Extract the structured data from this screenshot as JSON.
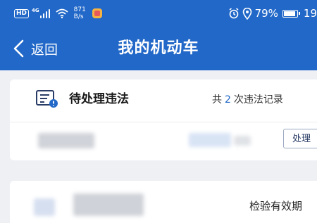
{
  "status_bar": {
    "hd_label": "HD",
    "network_type": "4G",
    "net_speed_value": "871",
    "net_speed_unit": "B/s",
    "battery_percent": "79%",
    "clock_partial": "19"
  },
  "nav": {
    "back_label": "返回",
    "title": "我的机动车"
  },
  "pending_violations": {
    "title": "待处理违法",
    "count_prefix": "共",
    "count": "2",
    "count_suffix": "次违法记录",
    "handle_button_label": "处理"
  },
  "vehicle_card": {
    "inspection_label": "检验有效期"
  },
  "colors": {
    "primary": "#2268c8",
    "background": "#eef0f4",
    "card": "#ffffff"
  },
  "icons": [
    "hd-icon",
    "signal-icon",
    "wifi-icon",
    "app-notification-icon",
    "alarm-icon",
    "location-icon",
    "battery-icon",
    "back-chevron-icon",
    "violation-document-icon"
  ]
}
